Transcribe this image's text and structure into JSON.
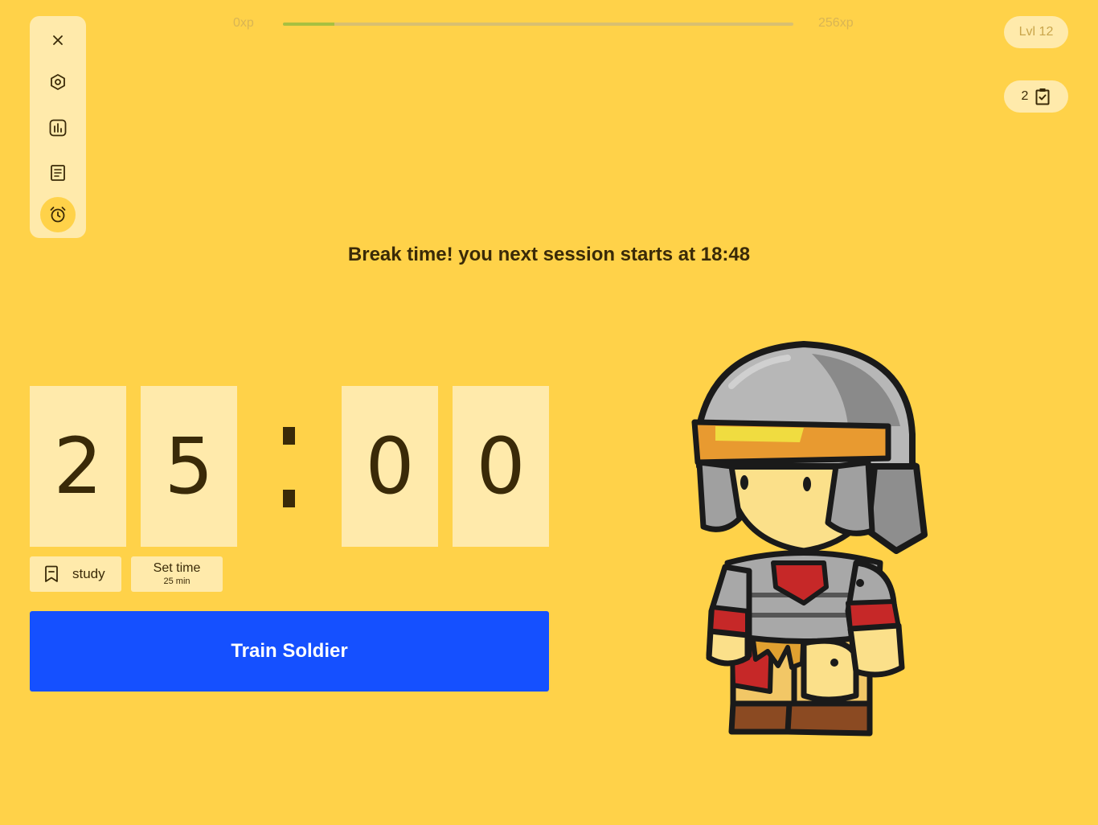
{
  "sidebar": {
    "items": [
      {
        "icon": "close-icon"
      },
      {
        "icon": "hexagon-settings-icon"
      },
      {
        "icon": "chart-icon"
      },
      {
        "icon": "notes-icon"
      },
      {
        "icon": "alarm-clock-icon",
        "active": true
      }
    ]
  },
  "xp": {
    "min_label": "0xp",
    "max_label": "256xp",
    "progress": 0.1
  },
  "level": {
    "label": "Lvl 12"
  },
  "tasks": {
    "count": "2",
    "icon": "clipboard-check-icon"
  },
  "message": "Break time! you next session starts at 18:48",
  "timer": {
    "digits": [
      "2",
      "5",
      "0",
      "0"
    ]
  },
  "category": {
    "label": "study",
    "icon": "bookmark-icon"
  },
  "set_time": {
    "label": "Set time",
    "value": "25 min"
  },
  "main_button": {
    "label": "Train Soldier"
  },
  "colors": {
    "background": "#FFD249",
    "panel": "#FFEAAB",
    "accent": "#1550FF",
    "text": "#3a2a08"
  }
}
